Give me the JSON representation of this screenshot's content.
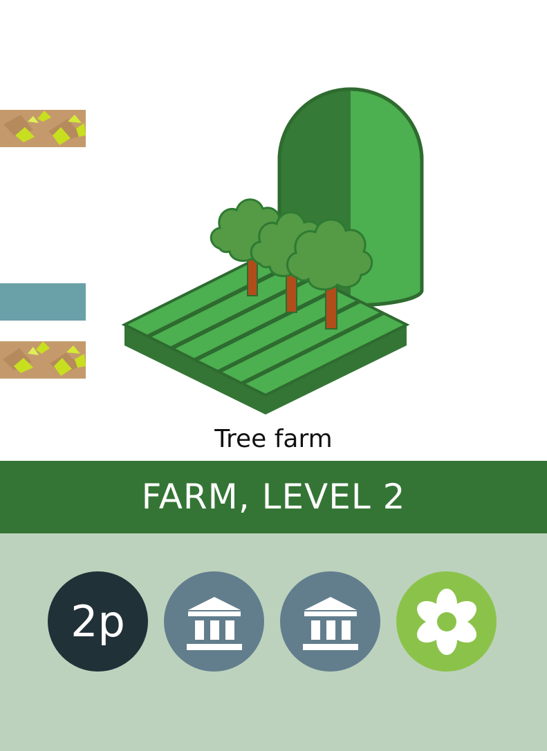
{
  "card": {
    "title": "Tree farm",
    "category": "FARM, LEVEL 2"
  },
  "icons": [
    {
      "name": "points-token",
      "text": "2p",
      "color": "#213138"
    },
    {
      "name": "museum-icon",
      "color": "#627e8d"
    },
    {
      "name": "museum-icon",
      "color": "#627e8d"
    },
    {
      "name": "flower-icon",
      "color": "#8bc34a"
    }
  ],
  "colors": {
    "band": "#347535",
    "footer": "#bcd2bd",
    "field_light": "#4caf50",
    "field_dark": "#347535",
    "trunk": "#b14d1a",
    "water": "#6aa0a8",
    "dirt": "#c49a6c"
  }
}
